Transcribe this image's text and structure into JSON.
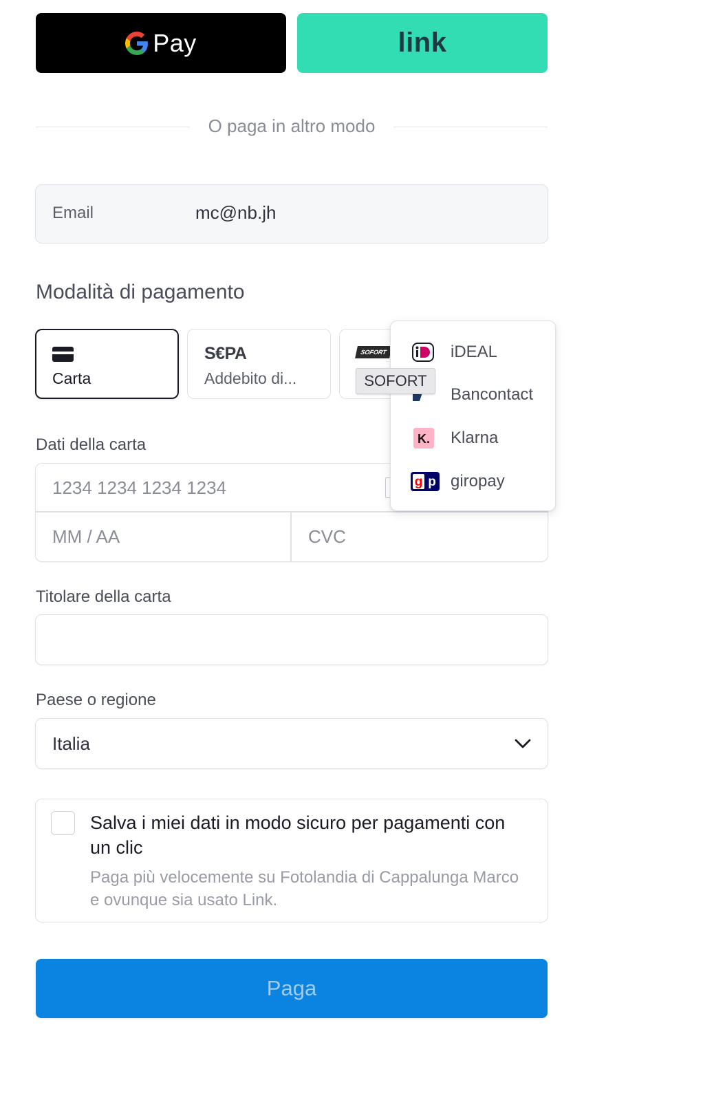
{
  "express": {
    "gpay_label": "Pay",
    "link_label": "link"
  },
  "divider": {
    "text": "O paga in altro modo"
  },
  "email": {
    "label": "Email",
    "value": "mc@nb.jh"
  },
  "payment": {
    "title": "Modalità di pagamento",
    "tabs": [
      {
        "label": "Carta",
        "icon": "credit-card-icon"
      },
      {
        "label": "Addebito di...",
        "logo": "S€PA"
      },
      {
        "logo": "SOFORT",
        "tooltip": "SOFORT"
      }
    ],
    "menu": [
      {
        "label": "iDEAL",
        "icon": "ideal-icon"
      },
      {
        "label": "Bancontact",
        "icon": "bancontact-icon"
      },
      {
        "label": "Klarna",
        "icon": "klarna-icon"
      },
      {
        "label": "giropay",
        "icon": "giropay-icon"
      }
    ]
  },
  "card": {
    "label": "Dati della carta",
    "number_placeholder": "1234 1234 1234 1234",
    "expiry_placeholder": "MM / AA",
    "cvc_placeholder": "CVC"
  },
  "holder": {
    "label": "Titolare della carta",
    "value": ""
  },
  "country": {
    "label": "Paese o regione",
    "value": "Italia"
  },
  "save": {
    "title": "Salva i miei dati in modo sicuro per pagamenti con un clic",
    "subtitle": "Paga più velocemente su Fotolandia di Cappalunga Marco e ovunque sia usato Link."
  },
  "pay_button": {
    "label": "Paga"
  },
  "colors": {
    "link_green": "#33ddb3",
    "pay_blue": "#0a84e0",
    "gpay_black": "#000000"
  }
}
